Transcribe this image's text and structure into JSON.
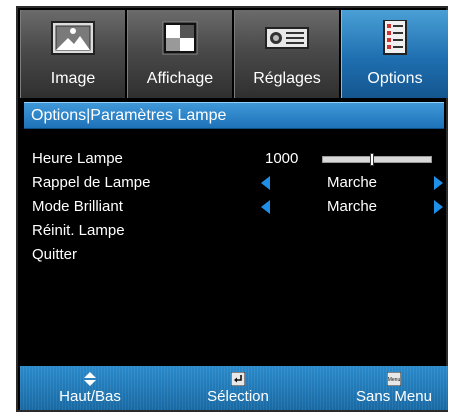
{
  "tabs": [
    {
      "label": "Image",
      "icon": "picture-icon",
      "active": false
    },
    {
      "label": "Affichage",
      "icon": "display-icon",
      "active": false
    },
    {
      "label": "Réglages",
      "icon": "settings-icon",
      "active": false
    },
    {
      "label": "Options",
      "icon": "options-icon",
      "active": true
    }
  ],
  "header": {
    "title": "Options|Paramètres Lampe"
  },
  "menu": {
    "lamp_hours": {
      "label": "Heure Lampe",
      "value": "1000",
      "level": 0.45
    },
    "lamp_reminder": {
      "label": "Rappel de Lampe",
      "value": "Marche"
    },
    "bright_mode": {
      "label": "Mode Brilliant",
      "value": "Marche"
    },
    "lamp_reset": {
      "label": "Réinit. Lampe"
    },
    "quit": {
      "label": "Quitter"
    }
  },
  "footer": {
    "up_down": {
      "label": "Haut/Bas",
      "icon": "up-down-icon"
    },
    "select": {
      "label": "Sélection",
      "icon": "enter-icon"
    },
    "menu": {
      "label": "Sans Menu",
      "icon": "menu-key-icon",
      "icon_text": "Menu"
    }
  },
  "colors": {
    "accent": "#1e72b8",
    "arrow": "#1f8fe8",
    "background": "#000000"
  }
}
